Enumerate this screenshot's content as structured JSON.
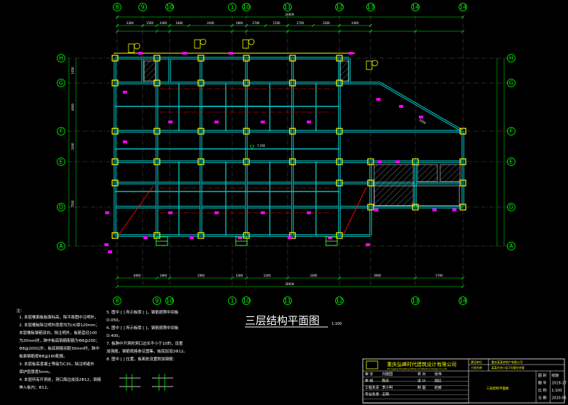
{
  "drawing": {
    "title": "三层结构平面图",
    "scale": "1:100",
    "total_dim_top": "24600",
    "total_dim_bottom": "24600",
    "dims_top": [
      "3300",
      "1500",
      "2400",
      "1800",
      "2400",
      "1800",
      "2700",
      "1500",
      "2700",
      "3300",
      "2400"
    ],
    "dims_bottom": [
      "4000",
      "1900",
      "1900",
      "3300",
      "1200",
      "3300",
      "3900",
      "5700"
    ],
    "dims_left": [
      "1050",
      "4000",
      "3300",
      "7500"
    ],
    "elev_mark": "7.350",
    "skew_label": "3200"
  },
  "axes": {
    "top": [
      "8",
      "9",
      "10",
      "1",
      "10",
      "11",
      "12",
      "13",
      "14",
      "14"
    ],
    "bottom": [
      "8",
      "9",
      "10",
      "1",
      "10",
      "11",
      "12",
      "13",
      "14"
    ],
    "left": [
      "H",
      "G",
      "F",
      "E",
      "D",
      "A"
    ],
    "right": [
      "H",
      "G",
      "F",
      "E",
      "D",
      "A"
    ]
  },
  "notes": {
    "heading": "注：",
    "items": [
      "1. 本层楼面板板面标高，除平面图中注明外，",
      "2. 本层楼板除注明外厚度均为(4)厚120mm；",
      "   本层楼板钢筋双向，除注明外，板筋直径100",
      "   为20mm时，跨中板底钢筋配筋为Φ8@200；",
      "   Φ8@200以外，板底钢筋间距30mm时，跨中",
      "   板面钢筋按Φ8@180配筋。",
      "3. 本层板底混凝土等级为C30，除注明者外",
      "   保护层厚度5mm。",
      "4. 本层所有开洞处，洞口周边加设2Φ12，钢筋",
      "   伸入板内；Φ12。"
    ],
    "right_items": [
      "5. 图中 [  ] 所示板厚 [  ]，钢筋按照中间板",
      "   D.050。",
      "6. 图中 [  ] 所示板厚 [  ]，钢筋按照中间板",
      "   D.400。",
      "7. 板跨中开洞时洞口边长不小于10的，设置",
      "   加强筋，钢筋规格参见图集，板底加设2Φ12。",
      "8. 图中 [ ] 位置，板面处设置附加钢筋："
    ]
  },
  "title_block": {
    "company": "重庆弘峰时代建筑设计有限公司",
    "company_en": "Chongqing Hongfeng Shidai Architecture Design Co.,Ltd.",
    "project_label1": "建设单位",
    "project_value1": "重庆某某房地产有限公司",
    "project_label2": "工程名称",
    "project_value2": "某某住宅小区1号楼住宅楼",
    "drawing_name": "三层结构平面图",
    "roles": [
      "审 定",
      "审 核",
      "工程负责",
      "专业负责",
      "校 对",
      "设 计",
      "制 图"
    ],
    "names": [
      "刘建国",
      "陈庆",
      "李小明",
      "王刚",
      "张伟",
      "周红",
      "赵敏"
    ],
    "fields": [
      "图 别",
      "图 号",
      "比 例",
      "日 期"
    ],
    "values": [
      "结施",
      "2019-17",
      "1:100",
      "2020.06"
    ]
  },
  "colors": {
    "background": "#000000",
    "beam": "#00bfbf",
    "column": "#ffff00",
    "axis_bubble": "#00ff00",
    "dimension": "#00ff00",
    "magenta_mark": "#ff00ff",
    "red_line": "#ff0000",
    "text": "#ffffff"
  }
}
